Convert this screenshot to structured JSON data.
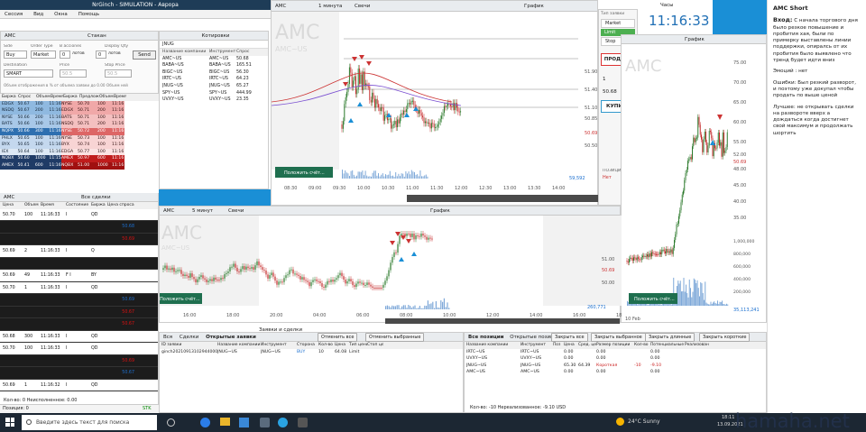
{
  "app": {
    "title": "NrGinch - SIMULATION - Аврора",
    "menu": [
      "Сессия",
      "Вид",
      "Окна",
      "Помощь"
    ]
  },
  "order_entry": {
    "symbol": "AMC",
    "tab": "Стакан",
    "labels": [
      "Side",
      "Order Type",
      "В acciones",
      "Display Qty"
    ],
    "side_opts": "Buy",
    "type": "Market",
    "qty": "0",
    "qty_unit": "лотов",
    "disp": "0",
    "disp_unit": "лотов",
    "send": "Send",
    "dest_label": "Destination",
    "price_label": "Price",
    "stop_label": "Stop Price",
    "dest": "SMART",
    "price": "50.5",
    "stop": "50.5",
    "note": "Объем отображения в % от объема заявки до 0.00   Объем ней"
  },
  "level2": {
    "headers": [
      "Биржа",
      "Спрос",
      "Объем",
      "Время",
      "Биржа",
      "Предлож",
      "Объем",
      "Время"
    ],
    "rows": [
      [
        "EDGX",
        "50.67",
        "100",
        "11:16",
        "NYSE",
        "50.70",
        "100",
        "11:16"
      ],
      [
        "NSDQ",
        "50.67",
        "200",
        "11:16",
        "EDGX",
        "50.71",
        "200",
        "11:16"
      ],
      [
        "NYSE",
        "50.66",
        "200",
        "11:16",
        "BATS",
        "50.71",
        "100",
        "11:16"
      ],
      [
        "BATS",
        "50.66",
        "100",
        "11:16",
        "NSDQ",
        "50.71",
        "200",
        "11:16"
      ],
      [
        "NQPX",
        "50.66",
        "300",
        "11:16",
        "NYSE",
        "50.72",
        "200",
        "11:16"
      ],
      [
        "PHLX",
        "50.65",
        "100",
        "11:16",
        "NYSE",
        "50.73",
        "100",
        "11:16"
      ],
      [
        "BYX",
        "50.65",
        "100",
        "11:16",
        "BYX",
        "50.74",
        "100",
        "11:16"
      ],
      [
        "IEX",
        "50.64",
        "100",
        "11:16",
        "EDGA",
        "50.77",
        "100",
        "11:16"
      ],
      [
        "NQBX",
        "50.60",
        "1000",
        "11:15",
        "AMEX",
        "50.97",
        "600",
        "11:16"
      ],
      [
        "AMEX",
        "50.41",
        "600",
        "11:16",
        "NQBX",
        "51.00",
        "1000",
        "11:16"
      ]
    ]
  },
  "quotes": {
    "title": "Котировки",
    "list": "JNUG",
    "headers": [
      "Название компании",
      "Инструмент",
      "Спрос",
      "Кол"
    ],
    "rows": [
      [
        "AMC~US",
        "AMC~US",
        "50.68"
      ],
      [
        "BABA~US",
        "BABA~US",
        "165.51"
      ],
      [
        "BIGC~US",
        "BIGC~US",
        "56.30"
      ],
      [
        "IRTC~US",
        "IRTC~US",
        "64.23"
      ],
      [
        "JNUG~US",
        "JNUG~US",
        "65.27"
      ],
      [
        "SPY~US",
        "SPY~US",
        "444.99"
      ],
      [
        "UVXY~US",
        "UVXY~US",
        "23.35"
      ]
    ]
  },
  "tape": {
    "symbol": "AMC",
    "title": "Все сделки",
    "headers": [
      "Цена",
      "Объем",
      "Время",
      "Состояние",
      "Биржа",
      "Цена спроса"
    ],
    "rows": [
      [
        "50.70",
        "100",
        "11:16:33",
        "I",
        "QD",
        ""
      ],
      [
        "",
        "",
        "",
        "",
        "",
        "50.68"
      ],
      [
        "",
        "",
        "",
        "",
        "",
        "50.69"
      ],
      [
        "50.69",
        "2",
        "11:16:33",
        "I",
        "Q",
        ""
      ],
      [
        "",
        "",
        "",
        "",
        "",
        ""
      ],
      [
        "50.69",
        "49",
        "11:16:33",
        "F I",
        "BY",
        ""
      ],
      [
        "50.70",
        "1",
        "11:16:33",
        "I",
        "QD",
        ""
      ],
      [
        "",
        "",
        "",
        "",
        "",
        "50.69"
      ],
      [
        "",
        "",
        "",
        "",
        "",
        "50.67"
      ],
      [
        "",
        "",
        "",
        "",
        "",
        "50.67"
      ],
      [
        "50.68",
        "300",
        "11:16:33",
        "I",
        "QD",
        ""
      ],
      [
        "50.70",
        "100",
        "11:16:33",
        "I",
        "QD",
        ""
      ],
      [
        "",
        "",
        "",
        "",
        "",
        "50.69"
      ],
      [
        "",
        "",
        "",
        "",
        "",
        "50.67"
      ],
      [
        "50.69",
        "1",
        "11:16:32",
        "I",
        "QD",
        ""
      ]
    ],
    "footer": [
      "Кол-во: 0   Неисполненное: 0.00",
      "Позиция: 0",
      "STK"
    ]
  },
  "chart1": {
    "symbol": "AMC",
    "interval": "1 минута",
    "style": "Свечи",
    "title": "График",
    "watermark": "AMC",
    "sub": "AMC~US",
    "times": [
      "08:30",
      "09:00",
      "09:30",
      "10:00",
      "10:30",
      "11:00",
      "11:30",
      "12:00",
      "12:30",
      "13:00",
      "13:30",
      "14:00"
    ],
    "prices": [
      "51.90",
      "51.40",
      "51.10",
      "50.85",
      "50.69",
      "50.50"
    ],
    "vol": "59,592",
    "btn": "Положить счёт..."
  },
  "chart2": {
    "symbol": "AMC",
    "interval": "5 минут",
    "style": "Свечи",
    "title": "График",
    "watermark": "AMC",
    "sub": "AMC~US",
    "times": [
      "16:00",
      "18:00",
      "20:00",
      "04:00",
      "06:00",
      "08:00",
      "10:00",
      "12:00",
      "14:00",
      "16:00",
      "18:00"
    ],
    "prices": [
      "51.00",
      "50.69",
      "50.00"
    ],
    "vol": "260,771",
    "btn": "Положить счёт..."
  },
  "trade_panel": {
    "type_label": "Тип заявки",
    "types": [
      "Market",
      "Limit",
      "Stop"
    ],
    "sell": "ПРОДАТЬ",
    "buy": "КУПИТЬ",
    "qty": "1",
    "price": "50.68",
    "pos_label": "ПОЗИЦИЯ",
    "pos": "Нет"
  },
  "clock": {
    "title": "Часы",
    "time": "11:16:33"
  },
  "chart3": {
    "title": "График",
    "symbol": "AMC",
    "prices": [
      "75.00",
      "70.00",
      "65.00",
      "60.00",
      "55.00",
      "52.00",
      "50.69",
      "48.00",
      "45.00",
      "40.00",
      "35.00"
    ],
    "vol_levels": [
      "1,000,000",
      "800,000",
      "600,000",
      "400,000",
      "200,000"
    ],
    "vol": "35,113,241",
    "date": "10 Feb",
    "btn": "Положить счёт..."
  },
  "orders": {
    "tabs": [
      "Вся",
      "Сделки",
      "Открытые заявки"
    ],
    "title": "Заявки и сделки",
    "btn_cancel": "Отменить все",
    "btn_cancel_sel": "Отменить выбранные",
    "headers": [
      "ID заявки",
      "Название компании",
      "Инструмент",
      "Сторона",
      "Кол-во",
      "Цена",
      "Тип цены",
      "Стоп цен"
    ],
    "row": [
      "ginch20210913102944000037",
      "JNUG~US",
      "JNUG~US",
      "BUY",
      "10",
      "64.08",
      "Limit",
      ""
    ]
  },
  "positions": {
    "tabs": [
      "Все позиции",
      "Открытые позиции"
    ],
    "btns": [
      "Закрыть все",
      "Закрыть выбранное",
      "Закрыть длинные",
      "Закрыть короткие"
    ],
    "headers": [
      "Название компании",
      "Инструмент",
      "Поз",
      "Цена",
      "Сред. цена",
      "Размер позиции",
      "Кол-во",
      "Потенциальные",
      "Реализован"
    ],
    "rows": [
      [
        "IRTC~US",
        "IRTC~US",
        "",
        "0.00",
        "",
        "0.00",
        "",
        "0.00",
        ""
      ],
      [
        "UVXY~US",
        "UVXY~US",
        "",
        "0.00",
        "",
        "0.00",
        "",
        "0.00",
        ""
      ],
      [
        "JNUG~US",
        "JNUG~US",
        "",
        "65.30",
        "64.39",
        "Короткая",
        "-10",
        "-9.10",
        ""
      ],
      [
        "AMC~US",
        "AMC~US",
        "",
        "0.00",
        "",
        "0.00",
        "",
        "0.00",
        ""
      ]
    ],
    "footer": "Кол-во: -10    Нереализованное: -9.10 USD"
  },
  "notes": {
    "title": "AMC Short",
    "entry_label": "Вход:",
    "entry": "С начала торгового дня было резкое повышение и пробития хая, были по примерку выставлены линии поддержки, опиралсь от их пробития было выявлено что тренд будет идти вниз",
    "emotion": "Эмоций : нет",
    "errors": "Ошибки: Был резкий разворот, и поэтому уже докупал чтобы продать по выше ценой",
    "better": "Лучшее: не открывать сделки на развороте вверх а дождаться когда достигнет свой максимум и продолжать шортить"
  },
  "taskbar": {
    "search": "Введите здесь текст для поиска",
    "weather": "24°C  Sunny",
    "time": "18:11",
    "date": "13.09.2021"
  },
  "watermark": "hamaha.net"
}
